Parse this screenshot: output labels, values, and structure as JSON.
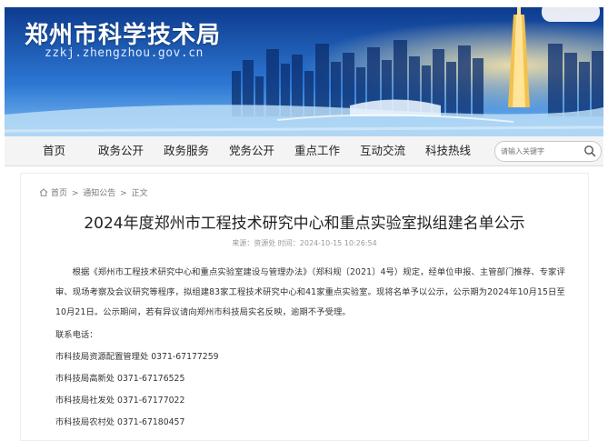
{
  "header": {
    "site_title": "郑州市科学技术局",
    "site_domain": "zzkj.zhengzhou.gov.cn"
  },
  "nav": {
    "items": [
      "首页",
      "政务公开",
      "政务服务",
      "党务公开",
      "重点工作",
      "互动交流",
      "科技热线"
    ],
    "search_placeholder": "请输入关键字"
  },
  "breadcrumb": [
    "首页",
    "通知公告",
    "正文"
  ],
  "article": {
    "title": "2024年度郑州市工程技术研究中心和重点实验室拟组建名单公示",
    "meta": "来源：资源处  时间：2024-10-15 10:26:54",
    "body": "根据《郑州市工程技术研究中心和重点实验室建设与管理办法》（郑科规〔2021〕4号）规定，经单位申报、主管部门推荐、专家评审、现场考察及会议研究等程序，拟组建83家工程技术研究中心和41家重点实验室。现将名单予以公示，公示期为2024年10月15日至10月21日。公示期间，若有异议请向郑州市科技局实名反映，逾期不予受理。",
    "contact_label": "联系电话：",
    "contacts": [
      "市科技局资源配置管理处 0371-67177259",
      "市科技局高新处 0371-67176525",
      "市科技局社发处 0371-67177022",
      "市科技局农村处 0371-67180457"
    ]
  },
  "colors": {
    "banner_top": "#0d3b8e",
    "banner_bottom": "#6fb2ee",
    "nav_bg": "#f4f4f4"
  }
}
